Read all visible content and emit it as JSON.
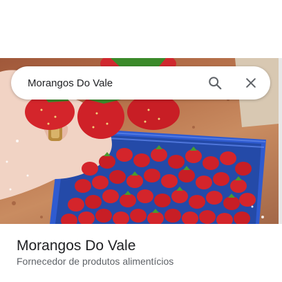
{
  "search": {
    "query": "Morangos Do Vale"
  },
  "place": {
    "name": "Morangos Do Vale",
    "category": "Fornecedor de produtos alimentícios"
  },
  "icons": {
    "search": "search-icon",
    "close": "close-icon"
  },
  "colors": {
    "basket": "#2f5bd0",
    "strawberry": "#d4252b"
  }
}
